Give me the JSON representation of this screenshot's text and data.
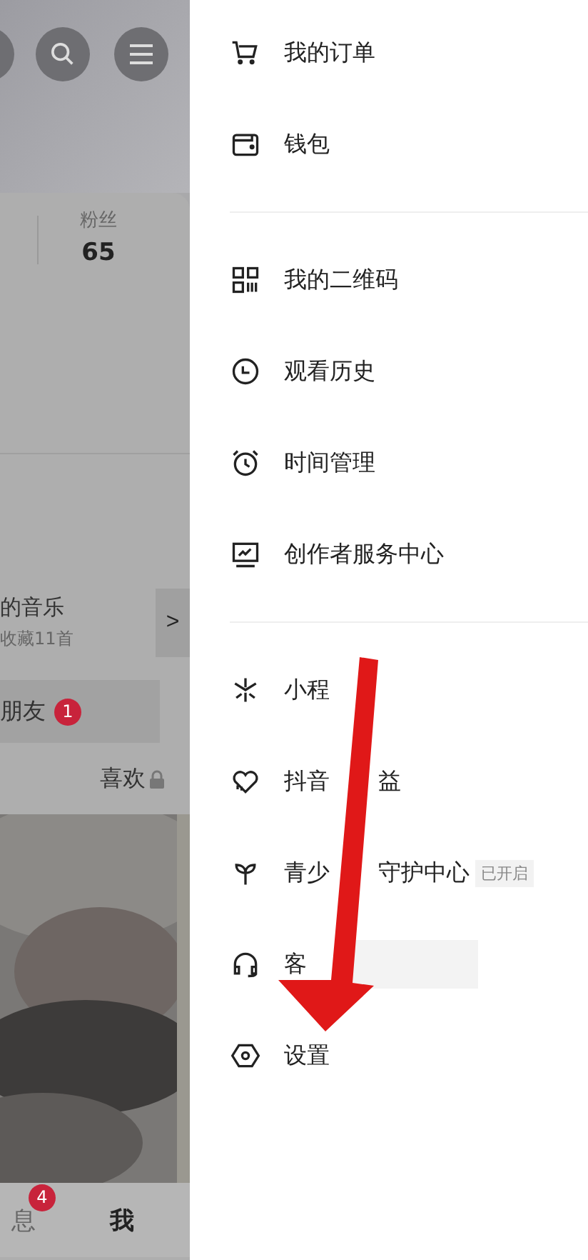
{
  "profile": {
    "stat": {
      "label": "粉丝",
      "value": "65"
    },
    "music": {
      "title": "的音乐",
      "subtitle": "收藏11首",
      "chevron": ">"
    },
    "friends": {
      "label": "朋友",
      "badge": "1"
    },
    "tab": {
      "label": "喜欢",
      "locked": true
    },
    "nav": [
      {
        "label": "息",
        "badge": "4",
        "selected": false
      },
      {
        "label": "我",
        "selected": true
      }
    ]
  },
  "drawer": {
    "sections": [
      [
        {
          "parts": [
            "我的订单"
          ]
        },
        {
          "parts": [
            "钱包"
          ]
        }
      ],
      [
        {
          "parts": [
            "我的二维码"
          ]
        },
        {
          "parts": [
            "观看历史"
          ]
        },
        {
          "parts": [
            "时间管理"
          ]
        },
        {
          "parts": [
            "创作者服务中心"
          ]
        }
      ],
      [
        {
          "parts": [
            "小程"
          ]
        },
        {
          "parts": [
            "抖音",
            "益"
          ]
        },
        {
          "parts": [
            "青少",
            "守护中心"
          ],
          "tag": "已开启"
        },
        {
          "parts": [
            "客"
          ],
          "masked": true
        },
        {
          "parts": [
            "设置"
          ]
        }
      ]
    ]
  }
}
